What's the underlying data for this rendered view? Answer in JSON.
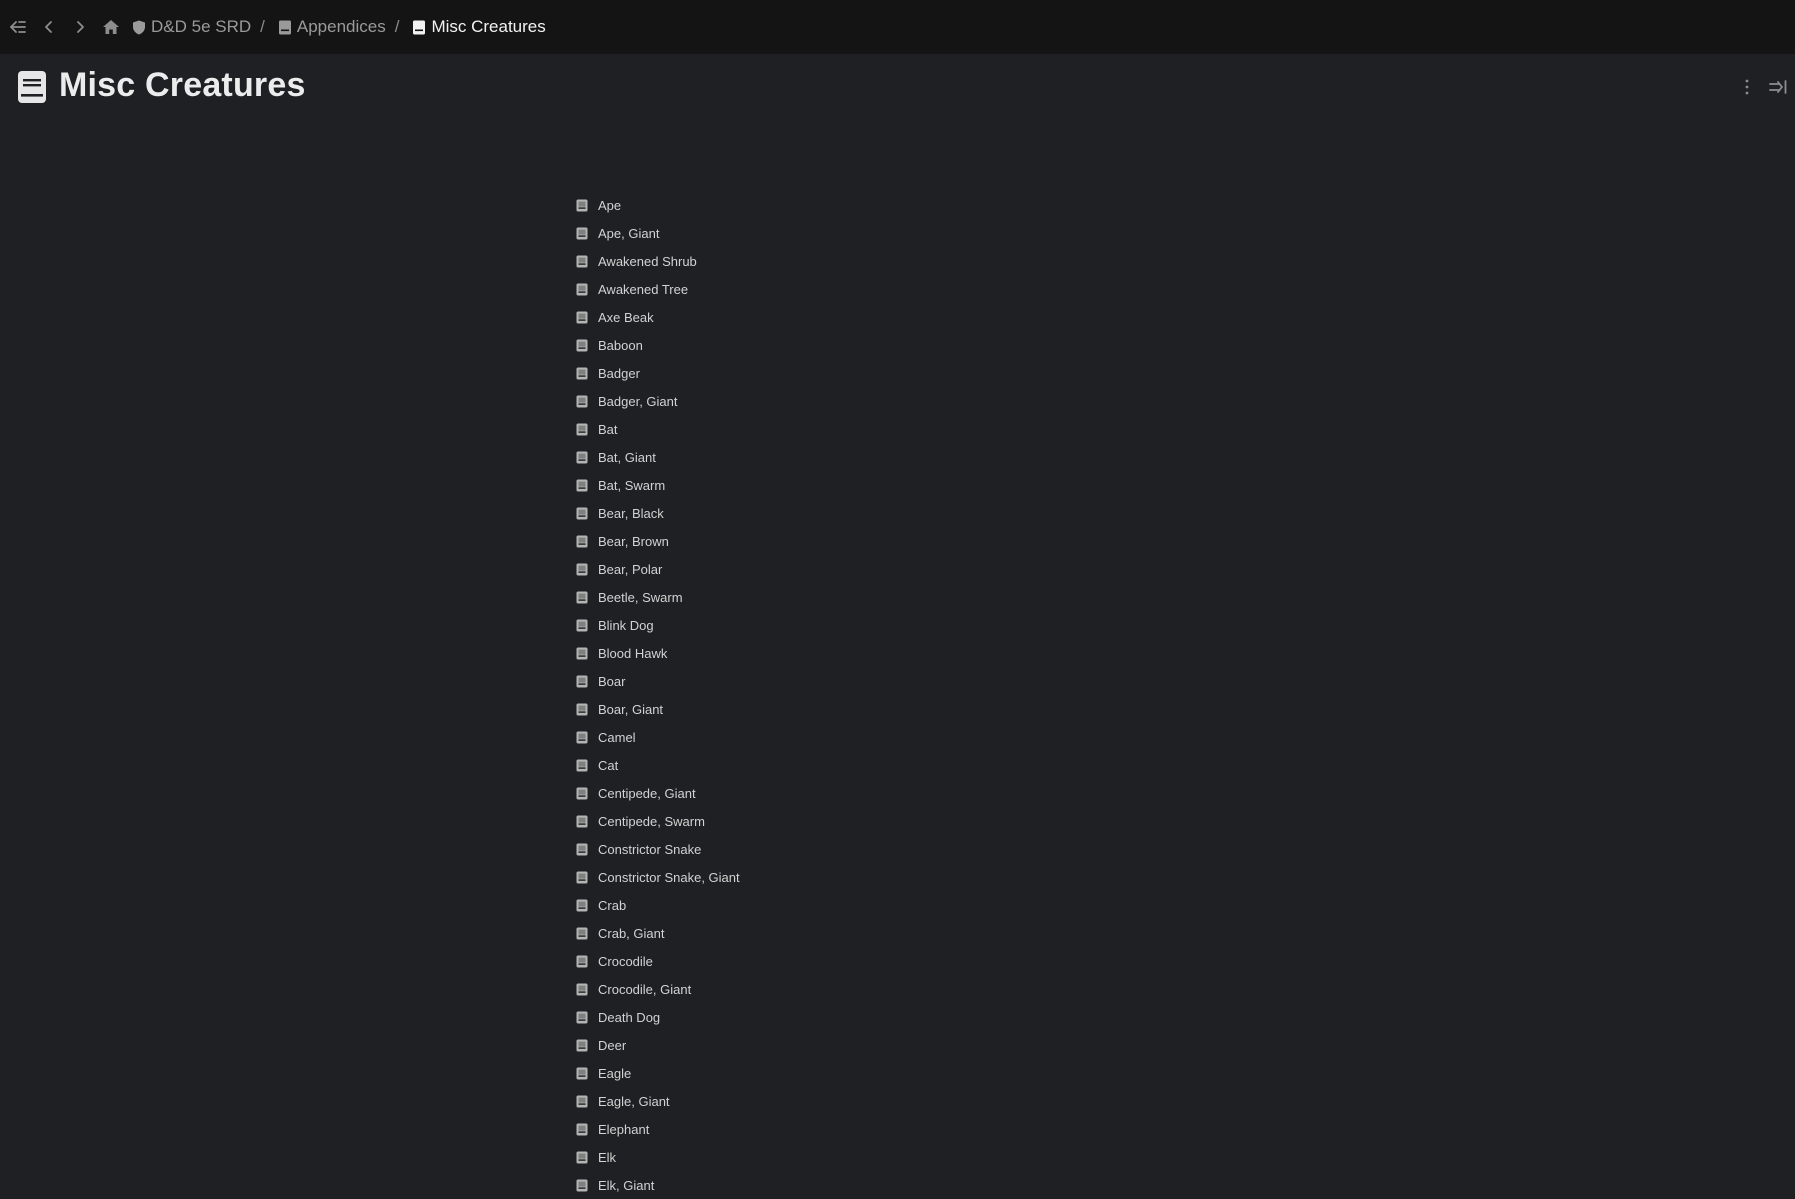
{
  "breadcrumb": {
    "items": [
      {
        "label": "D&D 5e SRD",
        "icon": "shield-icon"
      },
      {
        "label": "Appendices",
        "icon": "page-icon"
      },
      {
        "label": "Misc Creatures",
        "icon": "page-icon"
      }
    ],
    "separator": "/"
  },
  "header": {
    "title": "Misc Creatures",
    "icon": "page-icon"
  },
  "colors": {
    "background": "#1f2023",
    "topbar": "#141414",
    "text": "#d2d2d2",
    "muted": "#9a9a9a"
  },
  "creatures": [
    "Ape",
    "Ape, Giant",
    "Awakened Shrub",
    "Awakened Tree",
    "Axe Beak",
    "Baboon",
    "Badger",
    "Badger, Giant",
    "Bat",
    "Bat, Giant",
    "Bat, Swarm",
    "Bear, Black",
    "Bear, Brown",
    "Bear, Polar",
    "Beetle, Swarm",
    "Blink Dog",
    "Blood Hawk",
    "Boar",
    "Boar, Giant",
    "Camel",
    "Cat",
    "Centipede, Giant",
    "Centipede, Swarm",
    "Constrictor Snake",
    "Constrictor Snake, Giant",
    "Crab",
    "Crab, Giant",
    "Crocodile",
    "Crocodile, Giant",
    "Death Dog",
    "Deer",
    "Eagle",
    "Eagle, Giant",
    "Elephant",
    "Elk",
    "Elk, Giant"
  ]
}
